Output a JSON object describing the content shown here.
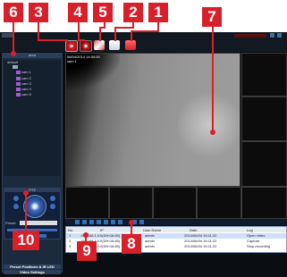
{
  "callouts": [
    "1",
    "2",
    "3",
    "4",
    "5",
    "6",
    "7",
    "8",
    "9",
    "10"
  ],
  "top_right_text": "",
  "sidebar": {
    "header": "area",
    "tree_root": "default",
    "tree_items": [
      "cam 1",
      "cam 2",
      "cam 3",
      "cam 4",
      "cam 5"
    ],
    "ptz_header": "PTZ",
    "preset_label": "Preset",
    "bottom_bar_1": "Preset Positions & IR LED",
    "bottom_bar_2": "Video Settings"
  },
  "video": {
    "timestamp": "06/04/2014 14:04:00",
    "name": "cam 1"
  },
  "log": {
    "headers": [
      "No.",
      "IP",
      "User Name",
      "Date",
      "Log"
    ],
    "rows": [
      [
        "1",
        "192.168.1.XX(DH:0A:80)",
        "admin",
        "2014/06/04 15:11:22",
        "Open video"
      ],
      [
        "2",
        "192.168.1.XX(DH:0A:80)",
        "admin",
        "2014/06/04 15:11:22",
        "Capture"
      ],
      [
        "3",
        "192.168.1.XX(DH:0A:80)",
        "admin",
        "2014/06/04 15:11:22",
        "Stop recording"
      ]
    ]
  },
  "colors": {
    "callout": "#d8202a",
    "app_bg": "#0a0d12",
    "sidebar_bg": "#1c2a3d",
    "accent_blue": "#2f6fb5"
  }
}
